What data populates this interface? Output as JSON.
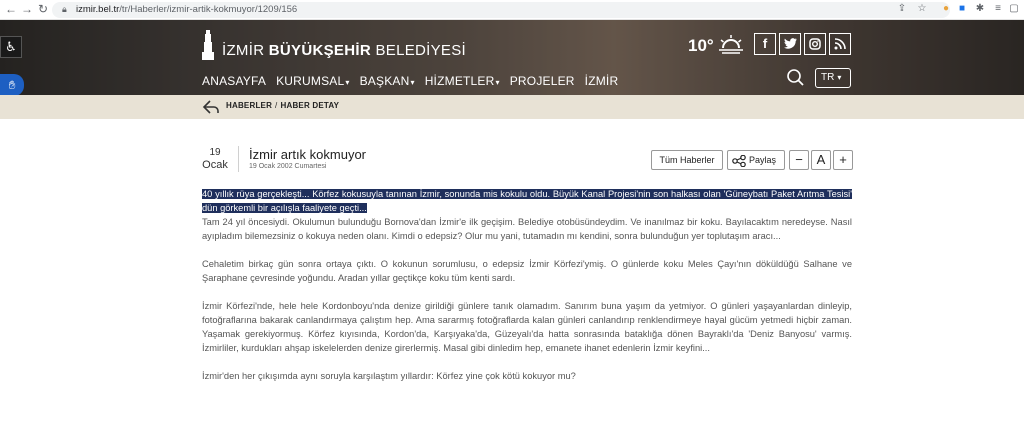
{
  "browser": {
    "url_host": "izmir.bel.tr",
    "url_path": "/tr/Haberler/izmir-artik-kokmuyor/1209/156"
  },
  "header": {
    "logo_prefix": "İZMİR",
    "logo_bold": "BÜYÜKŞEHİR",
    "logo_suffix": "BELEDİYESİ",
    "temperature": "10°",
    "social": [
      "f",
      "t",
      "ig",
      "rss"
    ],
    "menu": [
      {
        "label": "ANASAYFA",
        "dropdown": false
      },
      {
        "label": "KURUMSAL",
        "dropdown": true
      },
      {
        "label": "BAŞKAN",
        "dropdown": true
      },
      {
        "label": "HİZMETLER",
        "dropdown": true
      },
      {
        "label": "PROJELER",
        "dropdown": false
      },
      {
        "label": "İZMİR",
        "dropdown": false
      }
    ],
    "language": "TR"
  },
  "breadcrumb": {
    "items": [
      "HABERLER",
      "HABER DETAY"
    ],
    "separator": "/"
  },
  "article": {
    "day": "19",
    "month": "Ocak",
    "title": "İzmir artık kokmuyor",
    "full_date": "19 Ocak 2002 Cumartesi",
    "buttons": {
      "all_news": "Tüm Haberler",
      "share": "Paylaş",
      "font_decrease": "−",
      "font_default": "A",
      "font_increase": "+"
    },
    "lead": "40 yıllık rüya gerçekleşti... Körfez kokusuyla tanınan İzmir, sonunda mis kokulu oldu. Büyük Kanal Projesi'nin son halkası olan 'Güneybatı Paket Arıtma Tesisi' dün görkemli bir açılışla faaliyete geçti...",
    "paragraphs": [
      "Tam 24 yıl öncesiydi. Okulumun bulunduğu Bornova'dan İzmir'e ilk geçişim. Belediye otobüsündeydim. Ve inanılmaz bir koku. Bayılacaktım neredeyse. Nasıl ayıpladım bilemezsiniz o kokuya neden olanı. Kimdi o edepsiz? Olur mu yani, tutamadın mı kendini, sonra bulunduğun yer toplutaşım aracı...",
      "Cehaletim birkaç gün sonra ortaya çıktı. O kokunun sorumlusu, o edepsiz İzmir Körfezi'ymiş. O günlerde koku Meles Çayı'nın döküldüğü Salhane ve Şaraphane çevresinde yoğundu. Aradan yıllar geçtikçe koku tüm kenti sardı.",
      "İzmir Körfezi'nde, hele hele Kordonboyu'nda denize girildiği günlere tanık olamadım. Sanırım buna yaşım da yetmiyor. O günleri yaşayanlardan dinleyip, fotoğraflarına bakarak canlandırmaya çalıştım hep. Ama sararmış fotoğraflarda kalan günleri canlandırıp renklendirmeye hayal gücüm yetmedi hiçbir zaman. Yaşamak gerekiyormuş. Körfez kıyısında, Kordon'da, Karşıyaka'da, Güzeyalı'da hatta sonrasında bataklığa dönen Bayraklı'da 'Deniz Banyosu' varmış. İzmirliler, kurdukları ahşap iskelelerden denize girerlermiş. Masal gibi dinledim hep, emanete ihanet edenlerin İzmir keyfini...",
      "İzmir'den her çıkışımda aynı soruyla karşılaştım yıllardır: Körfez yine çok kötü kokuyor mu?"
    ]
  }
}
